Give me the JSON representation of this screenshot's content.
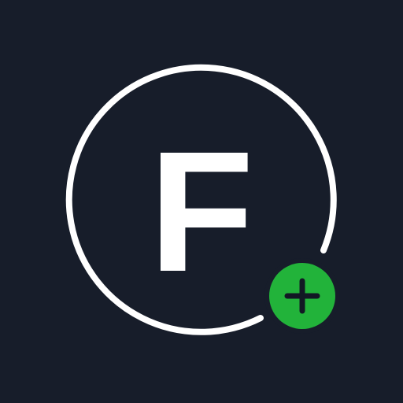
{
  "app_icon": {
    "letter": "F",
    "badge_icon": "plus-icon"
  },
  "colors": {
    "background": "#171d2a",
    "ring": "#ffffff",
    "letter": "#ffffff",
    "badge_fill": "#22b33a",
    "badge_border": "#171d2a",
    "plus": "#121824"
  }
}
